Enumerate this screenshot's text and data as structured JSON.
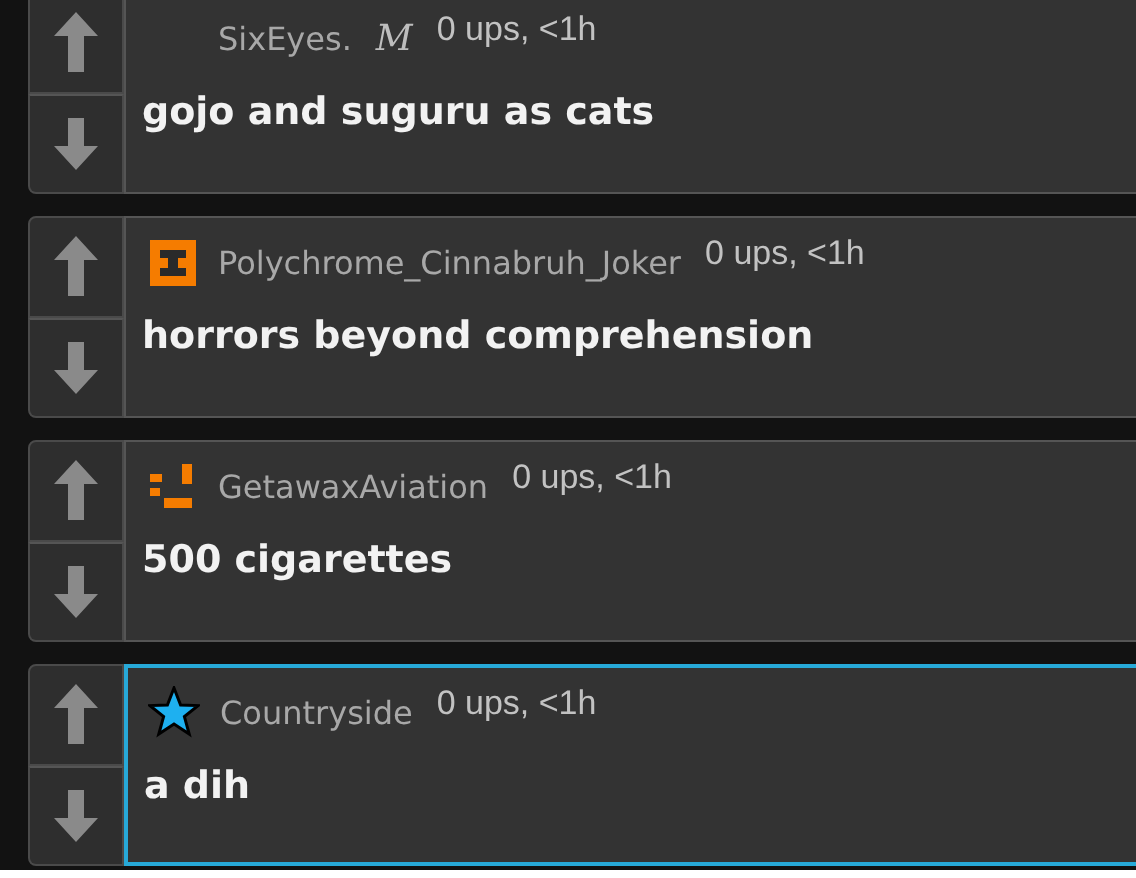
{
  "comments": [
    {
      "kind": "plain",
      "username": "SixEyes.",
      "flair": "M",
      "meta": "0 ups, <1h",
      "text": "gojo and suguru as cats",
      "highlighted": false
    },
    {
      "kind": "block",
      "username": "Polychrome_Cinnabruh_Joker",
      "meta": "0 ups, <1h",
      "text": "horrors beyond comprehension",
      "highlighted": false
    },
    {
      "kind": "pixels",
      "username": "GetawaxAviation",
      "meta": "0 ups, <1h",
      "text": "500 cigarettes",
      "highlighted": false
    },
    {
      "kind": "star",
      "username": "Countryside",
      "meta": "0 ups, <1h",
      "text": "a dih",
      "highlighted": true
    }
  ]
}
